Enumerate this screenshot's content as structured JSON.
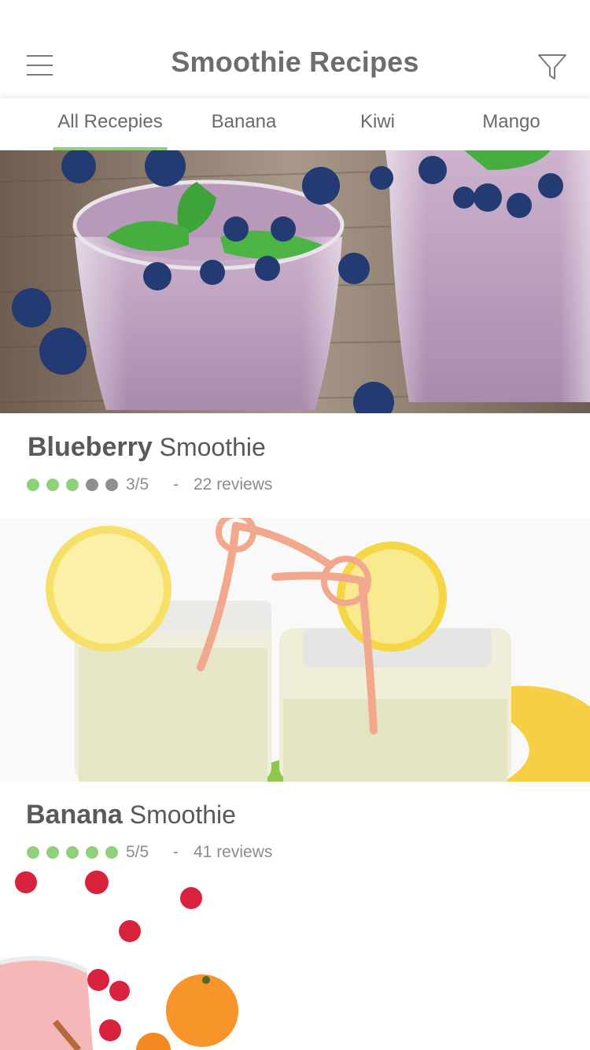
{
  "app": {
    "title": "Smoothie Recipes"
  },
  "header": {
    "menu_icon": "hamburger-menu-icon",
    "filter_icon": "filter-funnel-icon"
  },
  "tabs": [
    {
      "label": "All Recepies",
      "active": true
    },
    {
      "label": "Banana",
      "active": false
    },
    {
      "label": "Kiwi",
      "active": false
    },
    {
      "label": "Mango",
      "active": false
    }
  ],
  "colors": {
    "accent": "#8fd07a",
    "rating_on": "#8fd07a",
    "rating_off": "#8f8f8f",
    "title_text": "#6d6d6d"
  },
  "recipes": [
    {
      "name": "Blueberry",
      "suffix": "Smoothie",
      "rating": 3,
      "rating_max": 5,
      "rating_text": "3/5",
      "separator": "-",
      "reviews": "22 reviews",
      "image": "blueberry-smoothie-photo"
    },
    {
      "name": "Banana",
      "suffix": "Smoothie",
      "rating": 5,
      "rating_max": 5,
      "rating_text": "5/5",
      "separator": "-",
      "reviews": "41 reviews",
      "image": "banana-smoothie-photo"
    },
    {
      "image": "raspberry-smoothie-photo"
    }
  ]
}
